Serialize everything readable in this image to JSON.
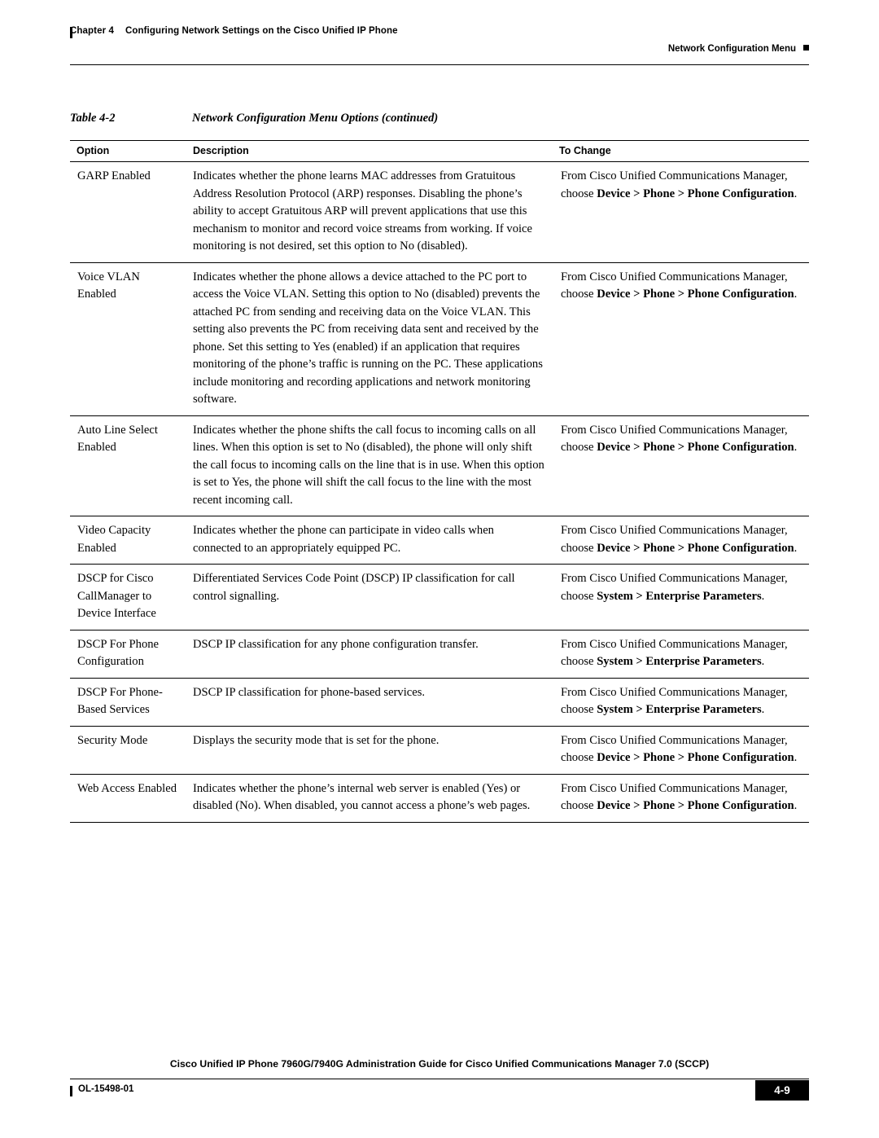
{
  "header": {
    "chapter": "Chapter 4",
    "chapter_title": "Configuring Network Settings on the Cisco Unified IP Phone",
    "section": "Network Configuration Menu"
  },
  "table": {
    "caption_number": "Table 4-2",
    "caption_title": "Network Configuration Menu Options (continued)",
    "columns": [
      "Option",
      "Description",
      "To Change"
    ],
    "rows": [
      {
        "option": "GARP Enabled",
        "description": "Indicates whether the phone learns MAC addresses from Gratuitous Address Resolution Protocol (ARP) responses. Disabling the phone’s ability to accept Gratuitous ARP will prevent applications that use this mechanism to monitor and record voice streams from working. If voice monitoring is not desired, set this option to No (disabled).",
        "to_change_plain": "From Cisco Unified Communications Manager, choose ",
        "to_change_bold1": "Device > Phone > Phone Configuration",
        "to_change_tail": "."
      },
      {
        "option": "Voice VLAN Enabled",
        "description": "Indicates whether the phone allows a device attached to the PC port to access the Voice VLAN. Setting this option to No (disabled) prevents the attached PC from sending and receiving data on the Voice VLAN. This setting also prevents the PC from receiving data sent and received by the phone. Set this setting to Yes (enabled) if an application that requires monitoring of the phone’s traffic is running on the PC. These applications include monitoring and recording applications and network monitoring software.",
        "to_change_plain": "From Cisco Unified Communications Manager, choose ",
        "to_change_bold1": "Device > Phone > Phone Configuration",
        "to_change_tail": "."
      },
      {
        "option": "Auto Line Select Enabled",
        "description": "Indicates whether the phone shifts the call focus to incoming calls on all lines. When this option is set to No (disabled), the phone will only shift the call focus to incoming calls on the line that is in use. When this option is set to Yes, the phone will shift the call focus to the line with the most recent incoming call.",
        "to_change_plain": "From Cisco Unified Communications Manager, choose ",
        "to_change_bold1": "Device > Phone > Phone Configuration",
        "to_change_tail": "."
      },
      {
        "option": "Video Capacity Enabled",
        "description": "Indicates whether the phone can participate in video calls when connected to an appropriately equipped PC.",
        "to_change_plain": "From Cisco Unified Communications Manager, choose ",
        "to_change_bold1": "Device > Phone > Phone Configuration",
        "to_change_tail": "."
      },
      {
        "option": "DSCP for Cisco CallManager to Device Interface",
        "description": "Differentiated Services Code Point (DSCP) IP classification for call control signalling.",
        "to_change_plain": "From Cisco Unified Communications Manager, choose ",
        "to_change_bold1": "System > Enterprise Parameters",
        "to_change_tail": "."
      },
      {
        "option": "DSCP For Phone Configuration",
        "description": "DSCP IP classification for any phone configuration transfer.",
        "to_change_plain": "From Cisco Unified Communications Manager, choose ",
        "to_change_bold1": "System > Enterprise Parameters",
        "to_change_tail": "."
      },
      {
        "option": "DSCP For Phone-Based Services",
        "description": "DSCP IP classification for phone-based services.",
        "to_change_plain": "From Cisco Unified Communications Manager, choose ",
        "to_change_bold1": "System > Enterprise Parameters",
        "to_change_tail": "."
      },
      {
        "option": "Security Mode",
        "description": "Displays the security mode that is set for the phone.",
        "to_change_plain": "From Cisco Unified Communications Manager, choose ",
        "to_change_bold1": "Device > Phone > Phone Configuration",
        "to_change_tail": "."
      },
      {
        "option": "Web Access Enabled",
        "description": "Indicates whether the phone’s internal web server is enabled (Yes) or disabled (No). When disabled, you cannot access a phone’s web pages.",
        "to_change_plain": "From Cisco Unified Communications Manager, choose ",
        "to_change_bold1": "Device > Phone > Phone Configuration",
        "to_change_tail": "."
      }
    ]
  },
  "footer": {
    "title": "Cisco Unified IP Phone 7960G/7940G Administration Guide for Cisco Unified Communications Manager 7.0 (SCCP)",
    "doc_id": "OL-15498-01",
    "page_number": "4-9"
  }
}
